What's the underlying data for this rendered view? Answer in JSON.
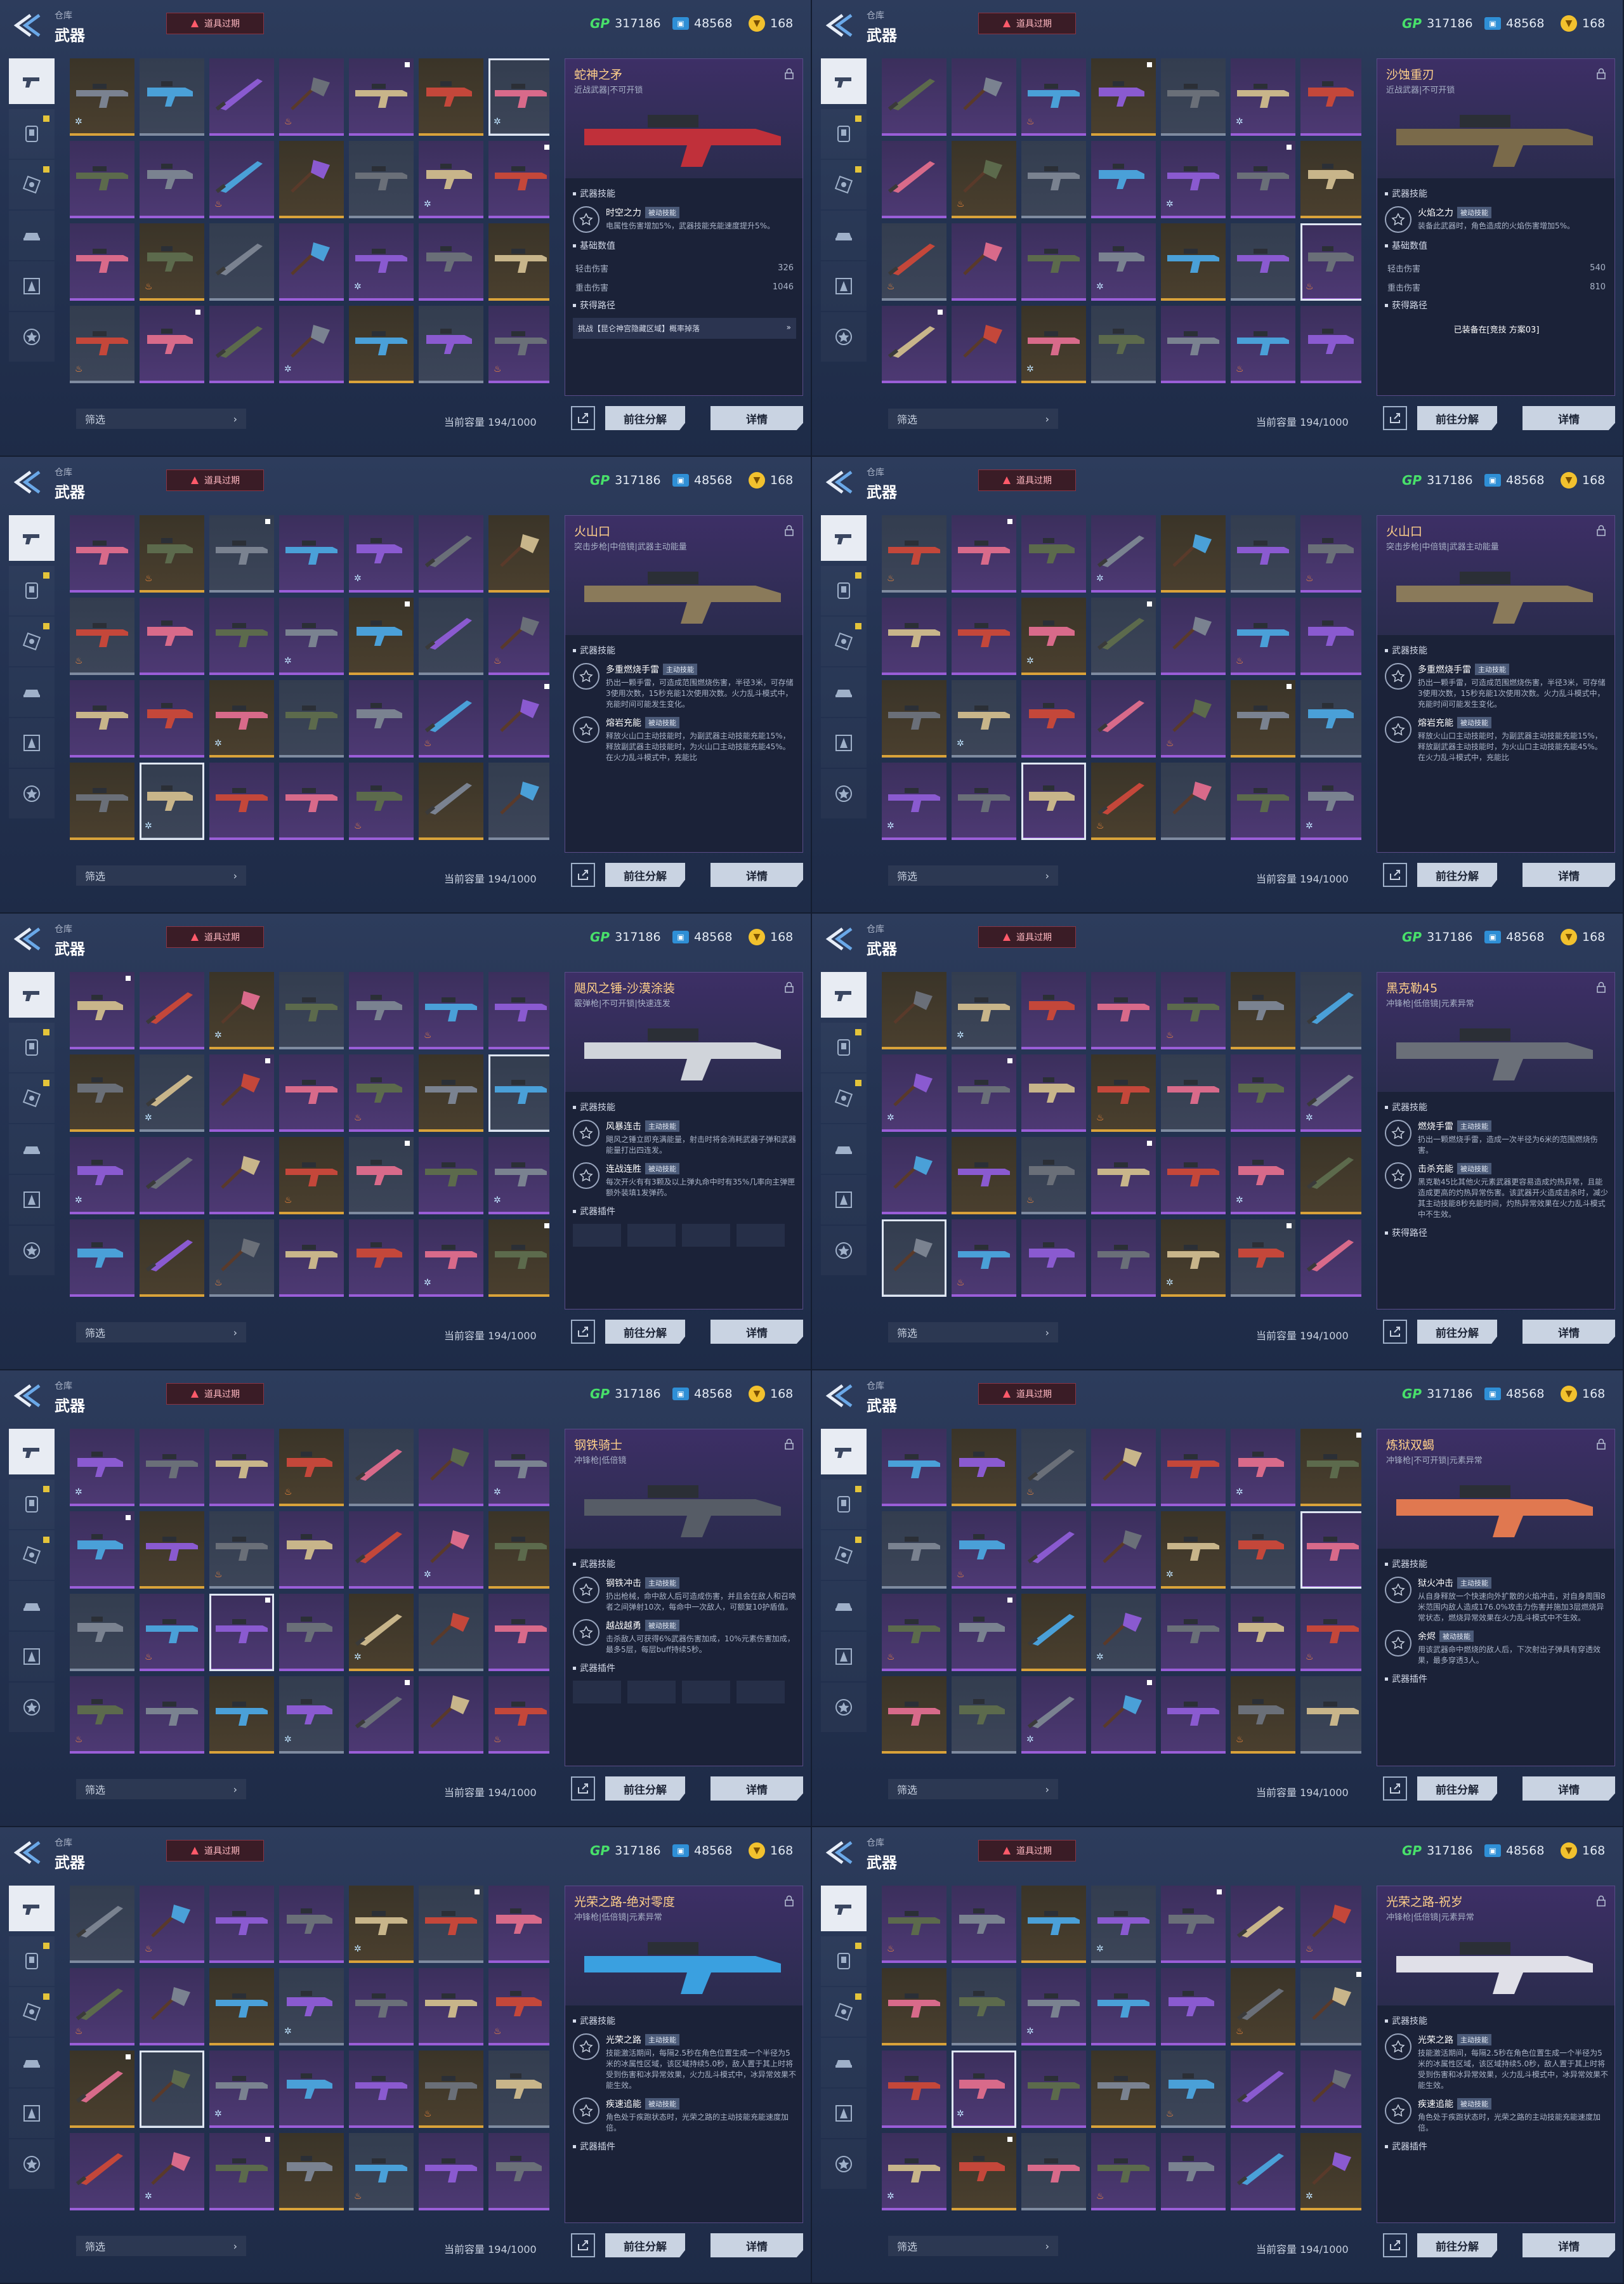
{
  "common": {
    "breadcrumb": "仓库",
    "title": "武器",
    "expire_button": "道具过期",
    "currency_gp_label": "GP",
    "currency_gp": "317186",
    "currency_ticket": "48568",
    "currency_coin": "168",
    "filter_label": "筛选",
    "capacity": "当前容量 194/1000",
    "decompose_button": "前往分解",
    "detail_button": "详情"
  },
  "rail_icons": [
    "pistol-icon",
    "armor-icon",
    "chip-icon",
    "vehicle-icon",
    "emblem-icon",
    "badge-icon"
  ],
  "panels": [
    {
      "weapon": {
        "name": "蛇神之矛",
        "type": "近战武器|不可开锁",
        "skills_section": "武器技能",
        "skills": [
          {
            "name": "时空之力",
            "tag": "被动技能",
            "desc": "电属性伤害增加5%，武器技能充能速度提升5%。"
          }
        ],
        "stats_section": "基础数值",
        "stats": [
          {
            "label": "轻击伤害",
            "value": "326"
          },
          {
            "label": "重击伤害",
            "value": "1046"
          }
        ],
        "obtain_section": "获得路径",
        "obtain": "挑战【昆仑神宫隐藏区域】概率掉落"
      }
    },
    {
      "weapon": {
        "name": "沙蚀重刃",
        "type": "近战武器|不可开锁",
        "skills_section": "武器技能",
        "skills": [
          {
            "name": "火焰之力",
            "tag": "被动技能",
            "desc": "装备此武器时，角色造成的火焰伤害增加5%。"
          }
        ],
        "stats_section": "基础数值",
        "stats": [
          {
            "label": "轻击伤害",
            "value": "540"
          },
          {
            "label": "重击伤害",
            "value": "810"
          }
        ],
        "obtain_section": "获得路径",
        "equipped": "已装备在[竞技 方案03]"
      }
    },
    {
      "weapon": {
        "name": "火山口",
        "type": "突击步枪|中倍镜|武器主动能量",
        "skills_section": "武器技能",
        "skills": [
          {
            "name": "多重燃烧手雷",
            "tag": "主动技能",
            "desc": "扔出一颗手雷，可造成范围燃烧伤害，半径3米，可存储3使用次数，15秒充能1次使用次数。火力乱斗模式中，充能时间可能发生变化。"
          },
          {
            "name": "熔岩充能",
            "tag": "被动技能",
            "desc": "释放火山口主动技能时，为副武器主动技能充能15%，释放副武器主动技能时，为火山口主动技能充能45%。在火力乱斗模式中，充能比"
          }
        ]
      }
    },
    {
      "weapon": {
        "name": "火山口",
        "type": "突击步枪|中倍镜|武器主动能量",
        "skills_section": "武器技能",
        "skills": [
          {
            "name": "多重燃烧手雷",
            "tag": "主动技能",
            "desc": "扔出一颗手雷，可造成范围燃烧伤害，半径3米，可存储3使用次数，15秒充能1次使用次数。火力乱斗模式中，充能时间可能发生变化。"
          },
          {
            "name": "熔岩充能",
            "tag": "被动技能",
            "desc": "释放火山口主动技能时，为副武器主动技能充能15%，释放副武器主动技能时，为火山口主动技能充能45%。在火力乱斗模式中，充能比"
          }
        ]
      }
    },
    {
      "weapon": {
        "name": "飓风之锤-沙漠涂装",
        "type": "霰弹枪|不可开锁|快速连发",
        "skills_section": "武器技能",
        "skills": [
          {
            "name": "风暴连击",
            "tag": "主动技能",
            "desc": "飓风之锤立即充满能量，射击时将会消耗武器子弹和武器能量打出四连发。"
          },
          {
            "name": "连战连胜",
            "tag": "被动技能",
            "desc": "每次开火有有3颗及以上弹丸命中时有35%几率向主弹匣额外装填1发弹药。"
          }
        ],
        "plugin_section": "武器插件"
      }
    },
    {
      "weapon": {
        "name": "黑克勒45",
        "type": "冲锋枪|低倍镜|元素异常",
        "skills_section": "武器技能",
        "skills": [
          {
            "name": "燃烧手雷",
            "tag": "主动技能",
            "desc": "扔出一颗燃烧手雷，造成一次半径为6米的范围燃烧伤害。"
          },
          {
            "name": "击杀充能",
            "tag": "被动技能",
            "desc": "黑克勒45比其他火元素武器更容易造成灼热异常，且能造成更高的灼热异常伤害。该武器开火造成击杀时，减少其主动技能8秒充能时间，灼热异常效果在火力乱斗模式中不生效。"
          }
        ],
        "obtain_section": "获得路径"
      }
    },
    {
      "weapon": {
        "name": "钢铁骑士",
        "type": "冲锋枪|低倍镜",
        "skills_section": "武器技能",
        "skills": [
          {
            "name": "钢铁冲击",
            "tag": "主动技能",
            "desc": "扔出枪械，命中敌人后可造成伤害，并且会在敌人和召唤者之间弹射10次，每命中一次敌人，可额复10护盾值。"
          },
          {
            "name": "越战越勇",
            "tag": "被动技能",
            "desc": "击杀敌人可获得6%武器伤害加成，10%元素伤害加成，最多5层，每层buff持续5秒。"
          }
        ],
        "plugin_section": "武器插件"
      }
    },
    {
      "weapon": {
        "name": "炼狱双蝎",
        "type": "冲锋枪|不可开锁|元素异常",
        "skills_section": "武器技能",
        "skills": [
          {
            "name": "狱火冲击",
            "tag": "主动技能",
            "desc": "从自身释放一个快速向外扩散的火焰冲击，对自身周围8米范围内敌人造成176.0%攻击力伤害并施加3层燃烧异常状态，燃烧异常效果在火力乱斗模式中不生效。"
          },
          {
            "name": "余烬",
            "tag": "被动技能",
            "desc": "用该武器命中燃烧的敌人后，下次射出子弹具有穿透效果，最多穿透3人。"
          }
        ],
        "obtain_section": "武器插件"
      }
    },
    {
      "weapon": {
        "name": "光荣之路-绝对零度",
        "type": "冲锋枪|低倍镜|元素异常",
        "skills_section": "武器技能",
        "skills": [
          {
            "name": "光荣之路",
            "tag": "主动技能",
            "desc": "技能激活期间，每隔2.5秒在角色位置生成一个半径为5米的冰属性区域，该区域持续5.0秒，敌人置于其上时将受到伤害和冰异常效果，火力乱斗模式中，冰异常效果不能生效。"
          },
          {
            "name": "疾速追能",
            "tag": "被动技能",
            "desc": "角色处于疾跑状态时，光荣之路的主动技能充能速度加倍。"
          }
        ],
        "obtain_section": "武器插件"
      }
    },
    {
      "weapon": {
        "name": "光荣之路-祝岁",
        "type": "冲锋枪|低倍镜|元素异常",
        "skills_section": "武器技能",
        "skills": [
          {
            "name": "光荣之路",
            "tag": "主动技能",
            "desc": "技能激活期间，每隔2.5秒在角色位置生成一个半径为5米的冰属性区域，该区域持续5.0秒，敌人置于其上时将受到伤害和冰异常效果，火力乱斗模式中，冰异常效果不能生效。"
          },
          {
            "name": "疾速追能",
            "tag": "被动技能",
            "desc": "角色处于疾跑状态时，光荣之路的主动技能充能速度加倍。"
          }
        ],
        "obtain_section": "武器插件"
      }
    }
  ],
  "colors": {
    "rarity_gold": "#d9a23a",
    "rarity_purple": "#9a5ed8",
    "rarity_gray": "#7f8ba0",
    "weapon_name": "#ffd08a",
    "fire": "#ff8d3a",
    "ice": "#bfe4ff"
  }
}
